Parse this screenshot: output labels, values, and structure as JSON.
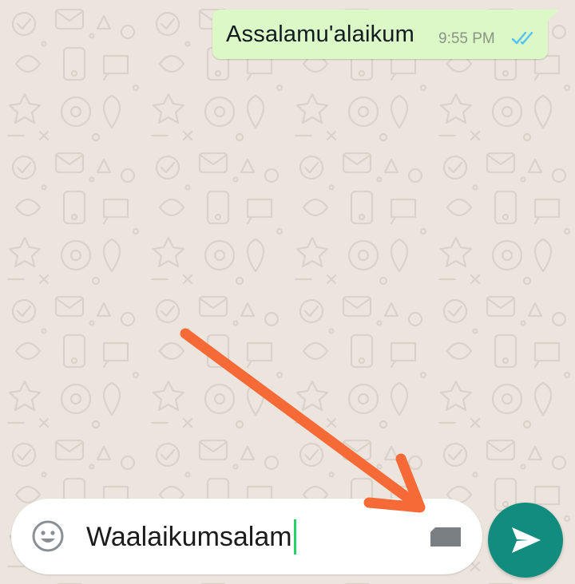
{
  "chat": {
    "wallpaper": "whatsapp-doodle-pattern",
    "background_color": "#ECE5DD",
    "messages": [
      {
        "text": "Assalamu'alaikum",
        "time": "9:55 PM",
        "direction": "outgoing",
        "status": "read",
        "status_icon": "double-check-icon",
        "bubble_color": "#DCF8C6",
        "tick_color": "#4FC3F7"
      }
    ]
  },
  "composer": {
    "emoji_icon": "emoji-icon",
    "value": "Waalaikumsalam",
    "attach_icon": "attachment-icon",
    "send_icon": "send-icon",
    "send_color": "#128C7E",
    "caret_color": "#25D366"
  },
  "annotation": {
    "shape": "arrow",
    "points_to": "attach-button",
    "color": "#F56A37"
  }
}
